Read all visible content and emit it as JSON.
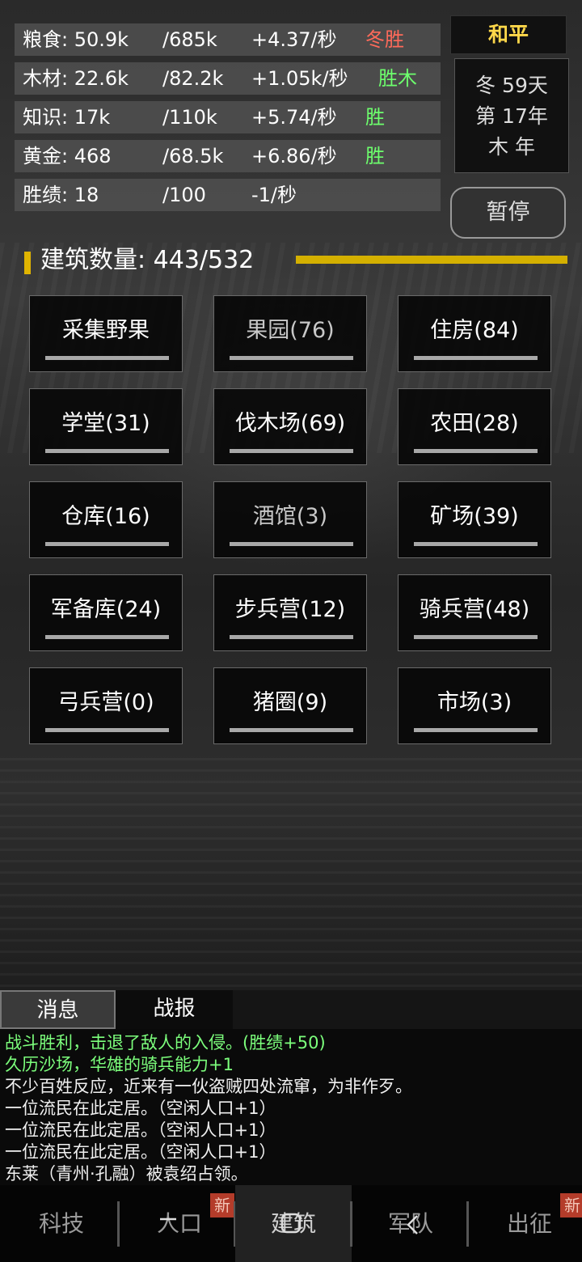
{
  "resources": [
    {
      "name": "粮食: 50.9k",
      "max": "/685k",
      "rate": "+4.37/秒",
      "tag": "冬胜",
      "tag_color": "red"
    },
    {
      "name": "木材: 22.6k",
      "max": "/82.2k",
      "rate": "+1.05k/秒",
      "tag": "胜木",
      "tag_color": "green"
    },
    {
      "name": "知识: 17k",
      "max": "/110k",
      "rate": "+5.74/秒",
      "tag": "胜",
      "tag_color": "green"
    },
    {
      "name": "黄金: 468",
      "max": "/68.5k",
      "rate": "+6.86/秒",
      "tag": "胜",
      "tag_color": "green"
    },
    {
      "name": "胜绩: 18",
      "max": "/100",
      "rate": "-1/秒",
      "tag": "",
      "tag_color": ""
    }
  ],
  "status": {
    "peace": "和平",
    "date_line1": "冬 59天",
    "date_line2": "第 17年",
    "date_line3": "木 年",
    "pause": "暂停"
  },
  "buildings_header": {
    "label": "建筑数量: 443/532",
    "bar_color": "#d4b000"
  },
  "buildings": [
    {
      "label": "采集野果",
      "dim": false
    },
    {
      "label": "果园(76)",
      "dim": true
    },
    {
      "label": "住房(84)",
      "dim": false
    },
    {
      "label": "学堂(31)",
      "dim": false
    },
    {
      "label": "伐木场(69)",
      "dim": false
    },
    {
      "label": "农田(28)",
      "dim": false
    },
    {
      "label": "仓库(16)",
      "dim": false
    },
    {
      "label": "酒馆(3)",
      "dim": true
    },
    {
      "label": "矿场(39)",
      "dim": false
    },
    {
      "label": "军备库(24)",
      "dim": false
    },
    {
      "label": "步兵营(12)",
      "dim": false
    },
    {
      "label": "骑兵营(48)",
      "dim": false
    },
    {
      "label": "弓兵营(0)",
      "dim": false
    },
    {
      "label": "猪圈(9)",
      "dim": false
    },
    {
      "label": "市场(3)",
      "dim": false
    }
  ],
  "tabs": {
    "messages": "消息",
    "battle_report": "战报"
  },
  "log": [
    {
      "text": "战斗胜利，击退了敌人的入侵。(胜绩+50)",
      "green": true
    },
    {
      "text": "久历沙场，华雄的骑兵能力+1",
      "green": true
    },
    {
      "text": "不少百姓反应，近来有一伙盗贼四处流窜，为非作歹。",
      "green": false
    },
    {
      "text": "一位流民在此定居。（空闲人口+1）",
      "green": false
    },
    {
      "text": "一位流民在此定居。（空闲人口+1）",
      "green": false
    },
    {
      "text": "一位流民在此定居。（空闲人口+1）",
      "green": false
    },
    {
      "text": "东莱（青州·孔融）被袁绍占领。",
      "green": false
    }
  ],
  "nav": {
    "tech": "科技",
    "population": "人口",
    "buildings": "建筑",
    "army": "军队",
    "campaign": "出征",
    "new_badge": "新"
  },
  "colors": {
    "accent": "#e0b400",
    "peace": "#ffd84a",
    "green_text": "#7cff7c",
    "red_tag": "#ff6a5a"
  }
}
